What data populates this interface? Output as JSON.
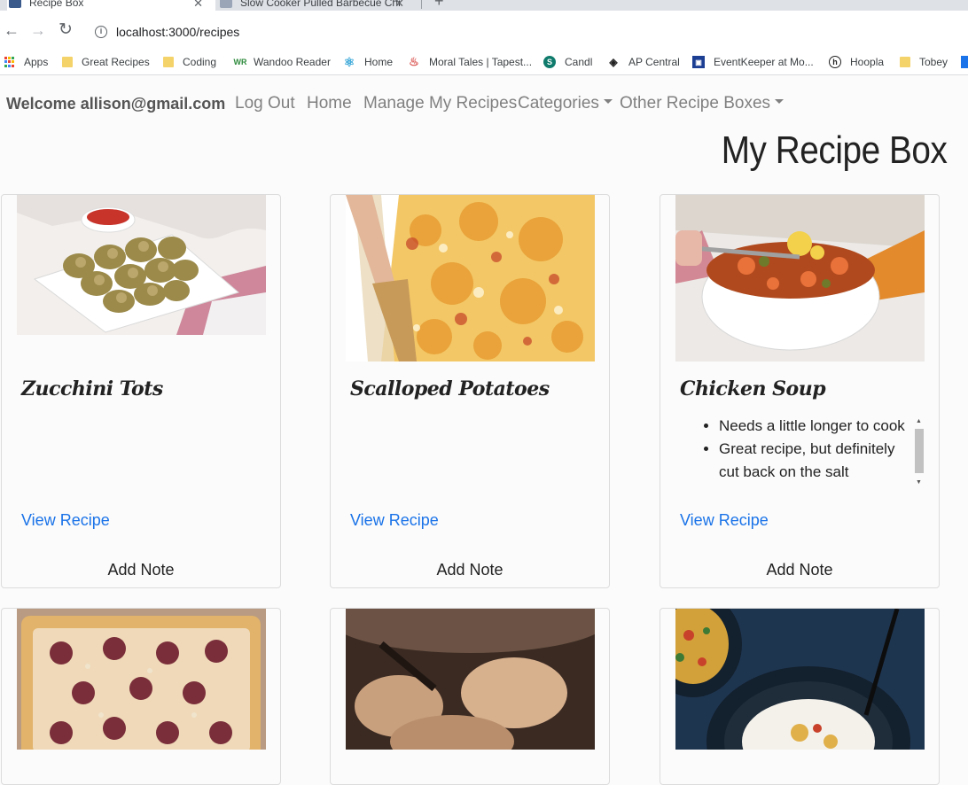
{
  "browser": {
    "tabs": [
      {
        "label": "Recipe Box",
        "active": true
      },
      {
        "label": "Slow Cooker Pulled Barbecue Chi",
        "active": false
      }
    ],
    "url": "localhost:3000/recipes",
    "bookmarks": [
      {
        "label": "Apps",
        "icon": "apps-grid-icon"
      },
      {
        "label": "Great Recipes",
        "icon": "folder-icon"
      },
      {
        "label": "Coding",
        "icon": "folder-icon"
      },
      {
        "label": "Wandoo Reader",
        "icon": "wandoo-icon"
      },
      {
        "label": "Home",
        "icon": "react-icon"
      },
      {
        "label": "Moral Tales | Tapest...",
        "icon": "flame-icon"
      },
      {
        "label": "Candl",
        "icon": "sharepoint-icon"
      },
      {
        "label": "AP Central",
        "icon": "acorn-icon"
      },
      {
        "label": "EventKeeper at Mo...",
        "icon": "eventkeeper-icon"
      },
      {
        "label": "Hoopla",
        "icon": "hoopla-icon"
      },
      {
        "label": "Tobey",
        "icon": "folder-icon"
      }
    ],
    "colors": {
      "tabstrip": "#dee1e6",
      "folder": "#f5d36b",
      "link": "#1a73e8"
    }
  },
  "nav": {
    "welcome": "Welcome allison@gmail.com",
    "logout": "Log Out",
    "home": "Home",
    "manage": "Manage My Recipes",
    "categories": "Categories",
    "other_boxes": "Other Recipe Boxes"
  },
  "page_title": "My Recipe Box",
  "recipes": [
    {
      "title": "Zucchini Tots",
      "notes": [],
      "view_label": "View Recipe",
      "add_note_label": "Add Note"
    },
    {
      "title": "Scalloped Potatoes",
      "notes": [],
      "view_label": "View Recipe",
      "add_note_label": "Add Note"
    },
    {
      "title": "Chicken Soup",
      "notes": [
        "Needs a little longer to cook",
        "Great recipe, but definitely cut back on the salt"
      ],
      "view_label": "View Recipe",
      "add_note_label": "Add Note"
    },
    {
      "title": "",
      "notes": []
    },
    {
      "title": "",
      "notes": []
    },
    {
      "title": "",
      "notes": []
    }
  ]
}
